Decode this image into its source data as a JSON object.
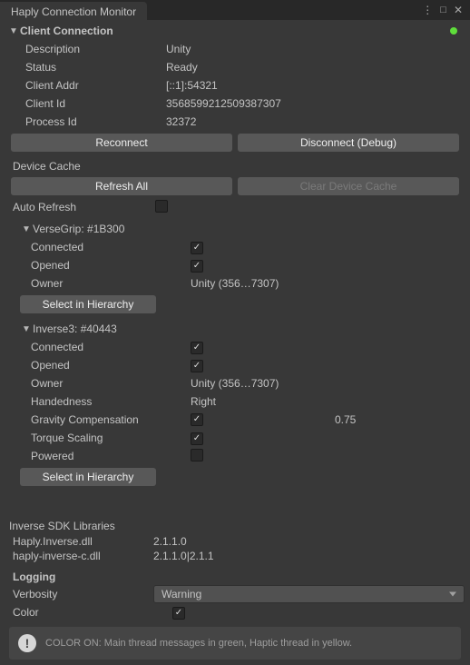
{
  "tab": {
    "title": "Haply Connection Monitor"
  },
  "status_dot_color": "#5FDE3B",
  "client_connection": {
    "header": "Client Connection",
    "description_label": "Description",
    "description_value": "Unity",
    "status_label": "Status",
    "status_value": "Ready",
    "client_addr_label": "Client Addr",
    "client_addr_value": "[::1]:54321",
    "client_id_label": "Client Id",
    "client_id_value": "3568599212509387307",
    "process_id_label": "Process Id",
    "process_id_value": "32372",
    "reconnect_btn": "Reconnect",
    "disconnect_btn": "Disconnect (Debug)"
  },
  "device_cache": {
    "header": "Device Cache",
    "refresh_btn": "Refresh All",
    "clear_btn": "Clear Device Cache",
    "auto_refresh_label": "Auto Refresh",
    "auto_refresh_checked": false
  },
  "devices": {
    "versegrip": {
      "header": "VerseGrip: #1B300",
      "connected_label": "Connected",
      "connected": true,
      "opened_label": "Opened",
      "opened": true,
      "owner_label": "Owner",
      "owner_value": "Unity (356…7307)",
      "select_btn": "Select in Hierarchy"
    },
    "inverse3": {
      "header": "Inverse3: #40443",
      "connected_label": "Connected",
      "connected": true,
      "opened_label": "Opened",
      "opened": true,
      "owner_label": "Owner",
      "owner_value": "Unity (356…7307)",
      "handedness_label": "Handedness",
      "handedness_value": "Right",
      "gravity_comp_label": "Gravity Compensation",
      "gravity_comp_checked": true,
      "gravity_comp_value": "0.75",
      "torque_scaling_label": "Torque Scaling",
      "torque_scaling_checked": true,
      "powered_label": "Powered",
      "powered_checked": false,
      "select_btn": "Select in Hierarchy"
    }
  },
  "libraries": {
    "header": "Inverse SDK Libraries",
    "dll1_name": "Haply.Inverse.dll",
    "dll1_version": "2.1.1.0",
    "dll2_name": "haply-inverse-c.dll",
    "dll2_version": "2.1.1.0|2.1.1"
  },
  "logging": {
    "header": "Logging",
    "verbosity_label": "Verbosity",
    "verbosity_value": "Warning",
    "color_label": "Color",
    "color_checked": true,
    "hint_text": "COLOR ON: Main thread messages in green, Haptic thread in yellow."
  }
}
